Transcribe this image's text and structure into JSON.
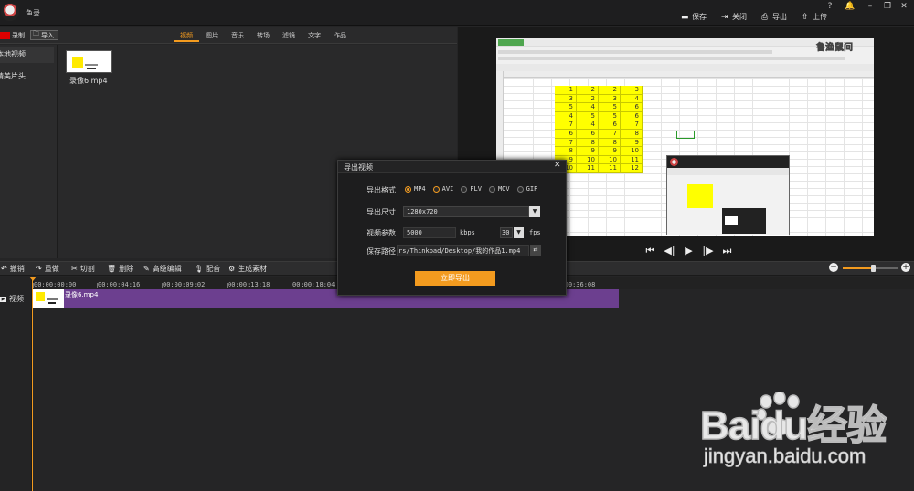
{
  "app": {
    "title": "鱼录"
  },
  "topbar": {
    "save": "保存",
    "close": "关闭",
    "export": "导出",
    "upload": "上传"
  },
  "window": {
    "help": "?",
    "minimize": "–",
    "restore": "❐",
    "close": "✕"
  },
  "media": {
    "record": "录制",
    "import": "导入",
    "tabs": [
      "视频",
      "图片",
      "音乐",
      "转场",
      "滤镜",
      "文字",
      "作品"
    ],
    "active_tab": 0,
    "sidebar": [
      "本地视频",
      "精美片头"
    ],
    "file": "录像6.mp4"
  },
  "preview": {
    "watermark": "鲁渔鼠间",
    "cells": [
      [
        1,
        2,
        2,
        3
      ],
      [
        3,
        2,
        3,
        4
      ],
      [
        5,
        4,
        5,
        6
      ],
      [
        4,
        5,
        5,
        6
      ],
      [
        7,
        4,
        6,
        7
      ],
      [
        6,
        6,
        7,
        8
      ],
      [
        7,
        8,
        8,
        9
      ],
      [
        8,
        9,
        9,
        10
      ],
      [
        9,
        10,
        10,
        11
      ],
      [
        10,
        11,
        11,
        12
      ]
    ]
  },
  "timeline_tools": [
    "撤销",
    "重做",
    "切割",
    "删除",
    "高级编辑",
    "配音",
    "生成素材"
  ],
  "timeline": {
    "track_label": "视频",
    "clip_label": "录像6.mp4",
    "ticks": [
      "00:00:00:00",
      "00:00:04:16",
      "00:00:09:02",
      "00:00:13:18",
      "00:00:18:04",
      "00:00:36:08"
    ],
    "zoom": 0.55
  },
  "dialog": {
    "title": "导出视频",
    "format_label": "导出格式",
    "formats": [
      "MP4",
      "AVI",
      "FLV",
      "MOV",
      "GIF"
    ],
    "selected_format": "MP4",
    "size_label": "导出尺寸",
    "size_value": "1280x720",
    "params_label": "视频参数",
    "bitrate": "5000",
    "bitrate_unit": "kbps",
    "fps": "30",
    "fps_unit": "fps",
    "path_label": "保存路径",
    "path": "rs/Thinkpad/Desktop/我的作品1.mp4",
    "export_button": "立即导出"
  },
  "watermark": {
    "brand": "Baidu经验",
    "url": "jingyan.baidu.com"
  }
}
